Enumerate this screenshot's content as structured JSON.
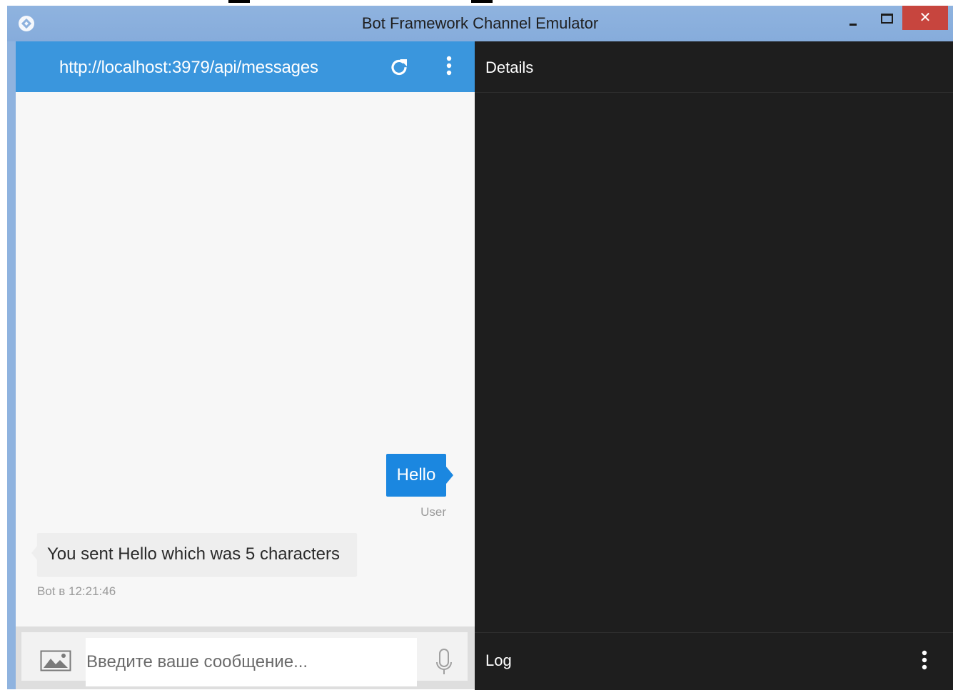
{
  "window": {
    "title": "Bot Framework Channel Emulator",
    "close_glyph": "✕"
  },
  "chat": {
    "endpoint_url": "http://localhost:3979/api/messages",
    "messages": [
      {
        "from": "user",
        "text": "Hello",
        "caption": "User",
        "bubble_color": "#1b87e0"
      },
      {
        "from": "bot",
        "text": "You sent Hello which was 5 characters",
        "caption": "Bot в 12:21:46",
        "bubble_color": "#eeeeee"
      }
    ],
    "input_placeholder": "Введите ваше сообщение..."
  },
  "details": {
    "title": "Details"
  },
  "log": {
    "title": "Log"
  },
  "icons": [
    "app-icon",
    "refresh-icon",
    "kebab-menu-icon",
    "image-upload-icon",
    "microphone-icon",
    "minimize-icon",
    "maximize-icon",
    "close-icon"
  ],
  "colors": {
    "titlebar": "#8fb3df",
    "chat_header": "#3a96dd",
    "dark_panel": "#1e1e1e",
    "chat_background": "#f7f7f7",
    "close_button": "#c7453e"
  }
}
